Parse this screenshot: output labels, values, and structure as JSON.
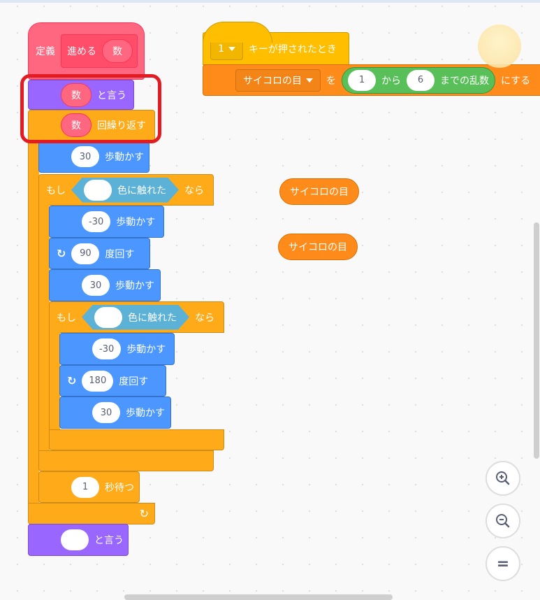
{
  "define": {
    "label": "定義",
    "name": "進める",
    "param": "数"
  },
  "say1": {
    "arg": "数",
    "label": "と言う"
  },
  "repeat": {
    "arg": "数",
    "label": "回繰り返す",
    "arrow": "↻"
  },
  "move1": {
    "value": "30",
    "label": "歩動かす"
  },
  "if1": {
    "if": "もし",
    "cond": "色に触れた",
    "then": "なら"
  },
  "move2": {
    "value": "-30",
    "label": "歩動かす"
  },
  "turn1": {
    "value": "90",
    "label": "度回す"
  },
  "move3": {
    "value": "30",
    "label": "歩動かす"
  },
  "if2": {
    "if": "もし",
    "cond": "色に触れた",
    "then": "なら"
  },
  "move4": {
    "value": "-30",
    "label": "歩動かす"
  },
  "turn2": {
    "value": "180",
    "label": "度回す"
  },
  "move5": {
    "value": "30",
    "label": "歩動かす"
  },
  "wait": {
    "value": "1",
    "label": "秒待つ"
  },
  "say2": {
    "arg": "",
    "label": "と言う"
  },
  "hat": {
    "key": "1",
    "label": "キーが押されたとき"
  },
  "setvar": {
    "variable": "サイコロの目",
    "to": "を",
    "from": "1",
    "kara": "から",
    "max": "6",
    "random": "までの乱数",
    "suffix": "にする"
  },
  "reporters": [
    "サイコロの目",
    "サイコロの目"
  ],
  "zoom": {
    "in": "zoom-in",
    "out": "zoom-out",
    "reset": "="
  },
  "colors": {
    "highlight": "#E31B23",
    "events": "#FFBF00",
    "control": "#FFAB19",
    "motion": "#4C97FF",
    "looks": "#9966FF",
    "variables": "#FF8C1A",
    "myblocks": "#FF6680",
    "sensing": "#5CB1D6"
  }
}
